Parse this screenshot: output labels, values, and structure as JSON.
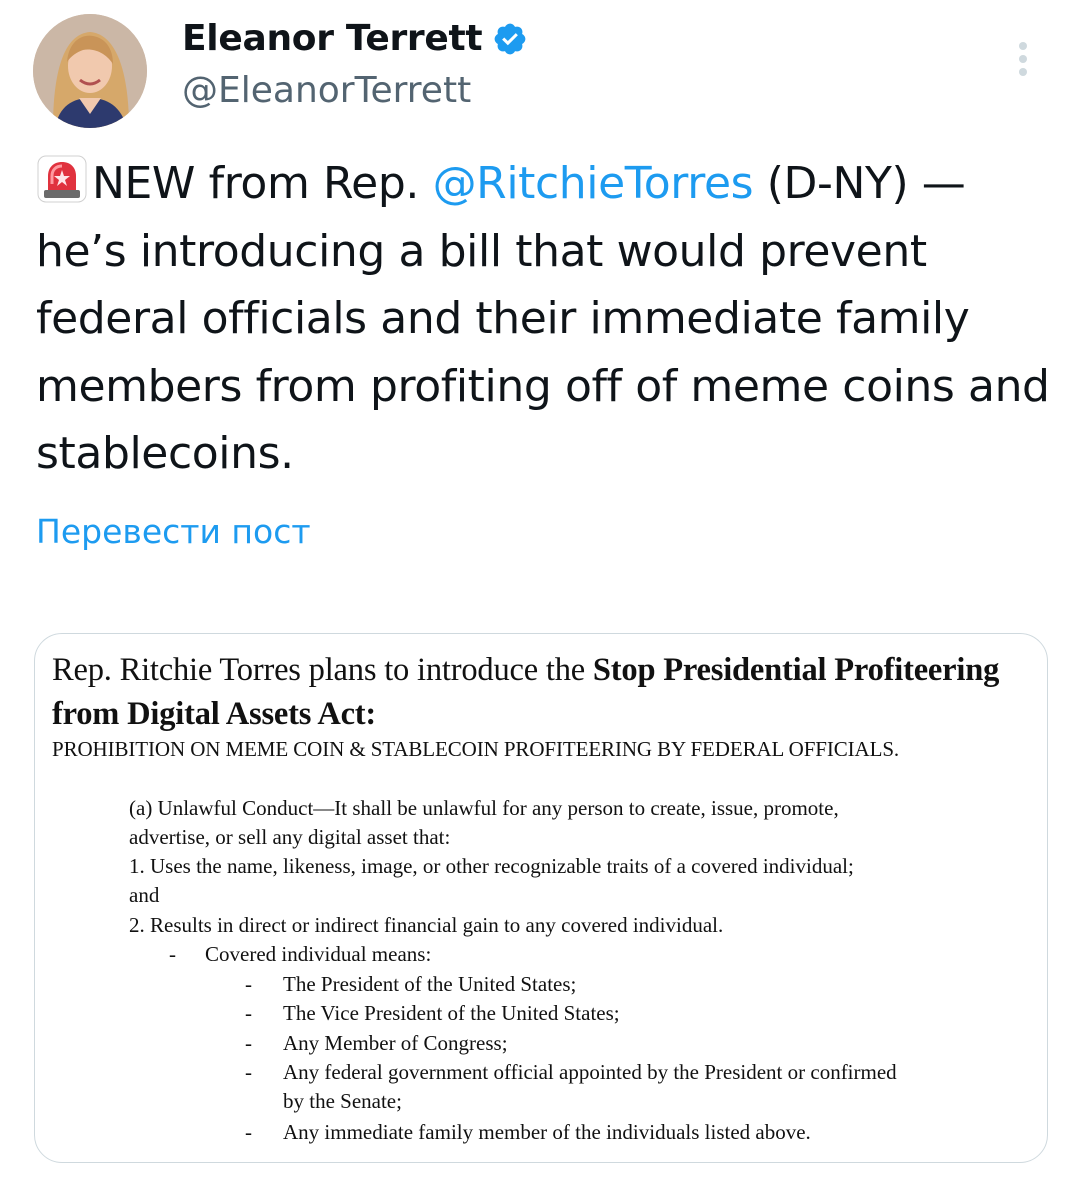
{
  "author": {
    "display_name": "Eleanor Terrett",
    "handle": "@EleanorTerrett",
    "verified_icon": "verified-badge-icon",
    "accent_color": "#1d9bf0"
  },
  "tweet": {
    "emoji": "rotating-light-icon",
    "text_before_mention": "NEW from Rep. ",
    "mention": "@RitchieTorres",
    "text_after_mention": " (D-NY) — he’s introducing a bill that would prevent federal officials and their immediate family members from profiting off of meme coins and stablecoins.",
    "translate_label": "Перевести пост"
  },
  "document": {
    "headline_plain": "Rep. Ritchie Torres plans to introduce the ",
    "headline_bold": "Stop Presidential Profiteering from Digital Assets Act:",
    "section_title": "PROHIBITION ON MEME COIN & STABLECOIN PROFITEERING BY FEDERAL OFFICIALS.",
    "para_a_line1": "(a) Unlawful Conduct—It shall be unlawful for any person to create, issue, promote,",
    "para_a_line2": "advertise, or sell any digital asset that:",
    "item1_line1": "1. Uses the name, likeness, image, or other recognizable traits of a covered individual;",
    "item1_line2": "and",
    "item2": "2. Results in direct or indirect financial gain to any covered individual.",
    "covered_label": "Covered individual means:",
    "covered_list": [
      "The President of the United States;",
      "The Vice President of the United States;",
      "Any Member of Congress;",
      "Any federal government official appointed by the President or confirmed",
      "by the Senate;",
      "Any immediate family member of the individuals listed above."
    ],
    "dash": "-"
  }
}
